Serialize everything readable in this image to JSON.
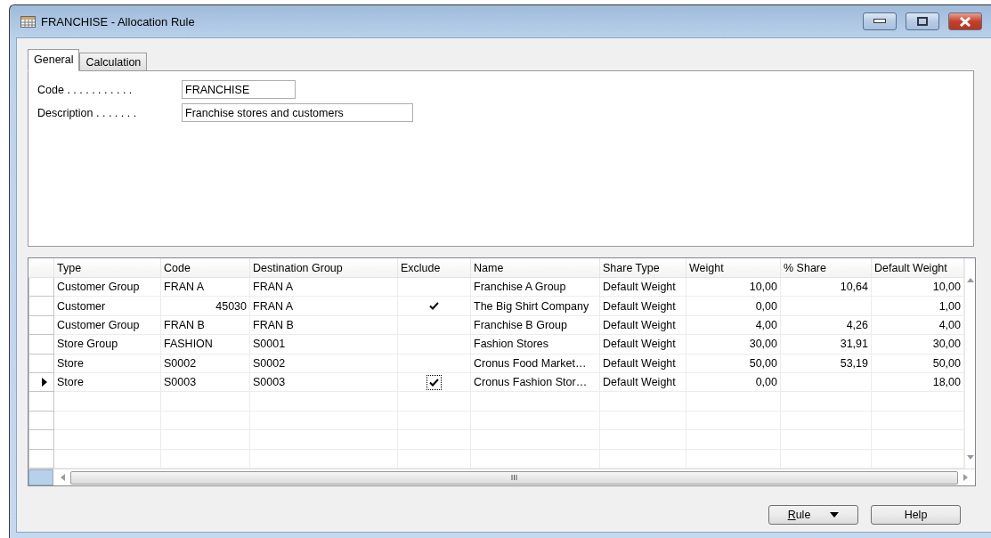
{
  "window": {
    "title": "FRANCHISE - Allocation Rule"
  },
  "tabs": [
    {
      "label": "General",
      "selected": true
    },
    {
      "label": "Calculation",
      "selected": false
    }
  ],
  "fields": [
    {
      "label": "Code",
      "dots": ". . . . . . . . . . .",
      "value": "FRANCHISE",
      "kind": "short"
    },
    {
      "label": "Description",
      "dots": ". . . . . . .",
      "value": "Franchise stores and customers",
      "kind": "long"
    }
  ],
  "table": {
    "columns": [
      {
        "label": "Type",
        "kind": "text"
      },
      {
        "label": "Code",
        "kind": "text"
      },
      {
        "label": "Destination Group",
        "kind": "text"
      },
      {
        "label": "Exclude",
        "kind": "check"
      },
      {
        "label": "Name",
        "kind": "text"
      },
      {
        "label": "Share Type",
        "kind": "text"
      },
      {
        "label": "Weight",
        "kind": "number"
      },
      {
        "label": "% Share",
        "kind": "number"
      },
      {
        "label": "Default Weight",
        "kind": "number"
      }
    ],
    "rows": [
      {
        "current": false,
        "cells": [
          {
            "text": "Customer Group"
          },
          {
            "text": "FRAN A"
          },
          {
            "text": "FRAN A"
          },
          {
            "checked": false,
            "focused": false
          },
          {
            "text": "Franchise A Group"
          },
          {
            "text": "Default Weight"
          },
          {
            "text": "10,00"
          },
          {
            "text": "10,64"
          },
          {
            "text": "10,00"
          }
        ]
      },
      {
        "current": false,
        "cells": [
          {
            "text": "Customer"
          },
          {
            "text": "45030",
            "kind": "number"
          },
          {
            "text": "FRAN A"
          },
          {
            "checked": true,
            "focused": false
          },
          {
            "text": "The Big Shirt Company"
          },
          {
            "text": "Default Weight"
          },
          {
            "text": "0,00"
          },
          {
            "text": ""
          },
          {
            "text": "1,00"
          }
        ]
      },
      {
        "current": false,
        "cells": [
          {
            "text": "Customer Group"
          },
          {
            "text": "FRAN B"
          },
          {
            "text": "FRAN B"
          },
          {
            "checked": false,
            "focused": false
          },
          {
            "text": "Franchise B Group"
          },
          {
            "text": "Default Weight"
          },
          {
            "text": "4,00"
          },
          {
            "text": "4,26"
          },
          {
            "text": "4,00"
          }
        ]
      },
      {
        "current": false,
        "cells": [
          {
            "text": "Store Group"
          },
          {
            "text": "FASHION"
          },
          {
            "text": "S0001"
          },
          {
            "checked": false,
            "focused": false
          },
          {
            "text": "Fashion Stores"
          },
          {
            "text": "Default Weight"
          },
          {
            "text": "30,00"
          },
          {
            "text": "31,91"
          },
          {
            "text": "30,00"
          }
        ]
      },
      {
        "current": false,
        "cells": [
          {
            "text": "Store"
          },
          {
            "text": "S0002"
          },
          {
            "text": "S0002"
          },
          {
            "checked": false,
            "focused": false
          },
          {
            "text": "Cronus Food Market…"
          },
          {
            "text": "Default Weight"
          },
          {
            "text": "50,00"
          },
          {
            "text": "53,19"
          },
          {
            "text": "50,00"
          }
        ]
      },
      {
        "current": true,
        "cells": [
          {
            "text": "Store"
          },
          {
            "text": "S0003"
          },
          {
            "text": "S0003"
          },
          {
            "checked": true,
            "focused": true
          },
          {
            "text": "Cronus Fashion Stor…"
          },
          {
            "text": "Default Weight"
          },
          {
            "text": "0,00"
          },
          {
            "text": ""
          },
          {
            "text": "18,00"
          }
        ]
      }
    ]
  },
  "buttons": [
    {
      "label": "Rule",
      "kind": "menu",
      "mnemonic_underlined": true
    },
    {
      "label": "Help",
      "kind": "plain",
      "mnemonic_underlined": false
    }
  ]
}
